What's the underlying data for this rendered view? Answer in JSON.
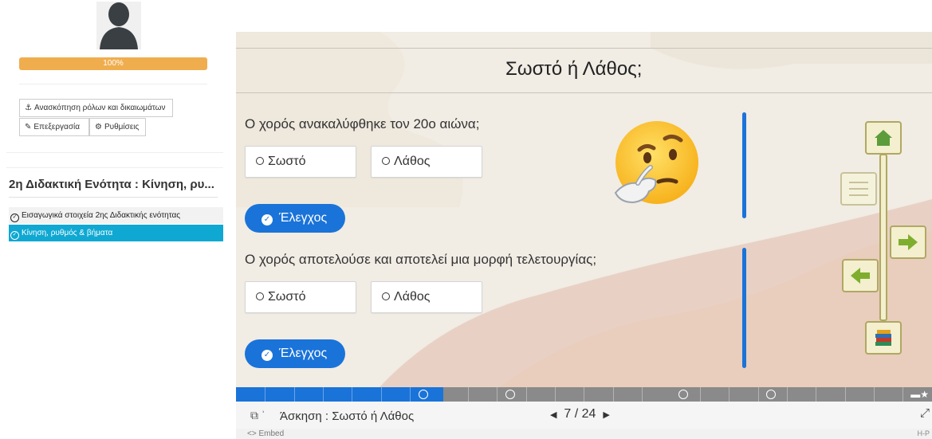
{
  "sidebar": {
    "progress_percent": 100,
    "progress_label": "100%",
    "buttons": {
      "roles": "Ανασκόπηση ρόλων και δικαιωμάτων",
      "edit": "Επεξεργασία",
      "settings": "Ρυθμίσεις"
    },
    "unit_title": "2η Διδακτική Ενότητα : Κίνηση, ρυ...",
    "lessons": [
      {
        "label": "Εισαγωγικά στοιχεία 2ης Διδακτικής ενότητας",
        "active": false
      },
      {
        "label": "Κίνηση, ρυθμός & βήματα",
        "active": true
      }
    ]
  },
  "slide": {
    "title": "Σωστό ή Λάθος;",
    "questions": [
      {
        "text": "Ο χορός ανακαλύφθηκε τον 20ο αιώνα;",
        "options": [
          "Σωστό",
          "Λάθος"
        ],
        "check_label": "Έλεγχος"
      },
      {
        "text": "Ο χορός αποτελούσε και αποτελεί μια μορφή τελετουργίας;",
        "options": [
          "Σωστό",
          "Λάθος"
        ],
        "check_label": "Έλεγχος"
      }
    ],
    "nav_icons": [
      "home-icon",
      "menu-icon",
      "arrow-right-icon",
      "arrow-left-icon",
      "books-icon"
    ]
  },
  "footer": {
    "slide_label": "Άσκηση : Σωστό ή Λάθος",
    "current_page": "7",
    "separator": "/",
    "total_pages": "24",
    "embed_label": "<> Embed",
    "brand": "H-P"
  },
  "colors": {
    "accent": "#1a73d9",
    "progress": "#f0ad4e",
    "active_lesson": "#0fa8d2",
    "nav_border": "#b0a862",
    "slide_bg": "#f1ece4"
  }
}
